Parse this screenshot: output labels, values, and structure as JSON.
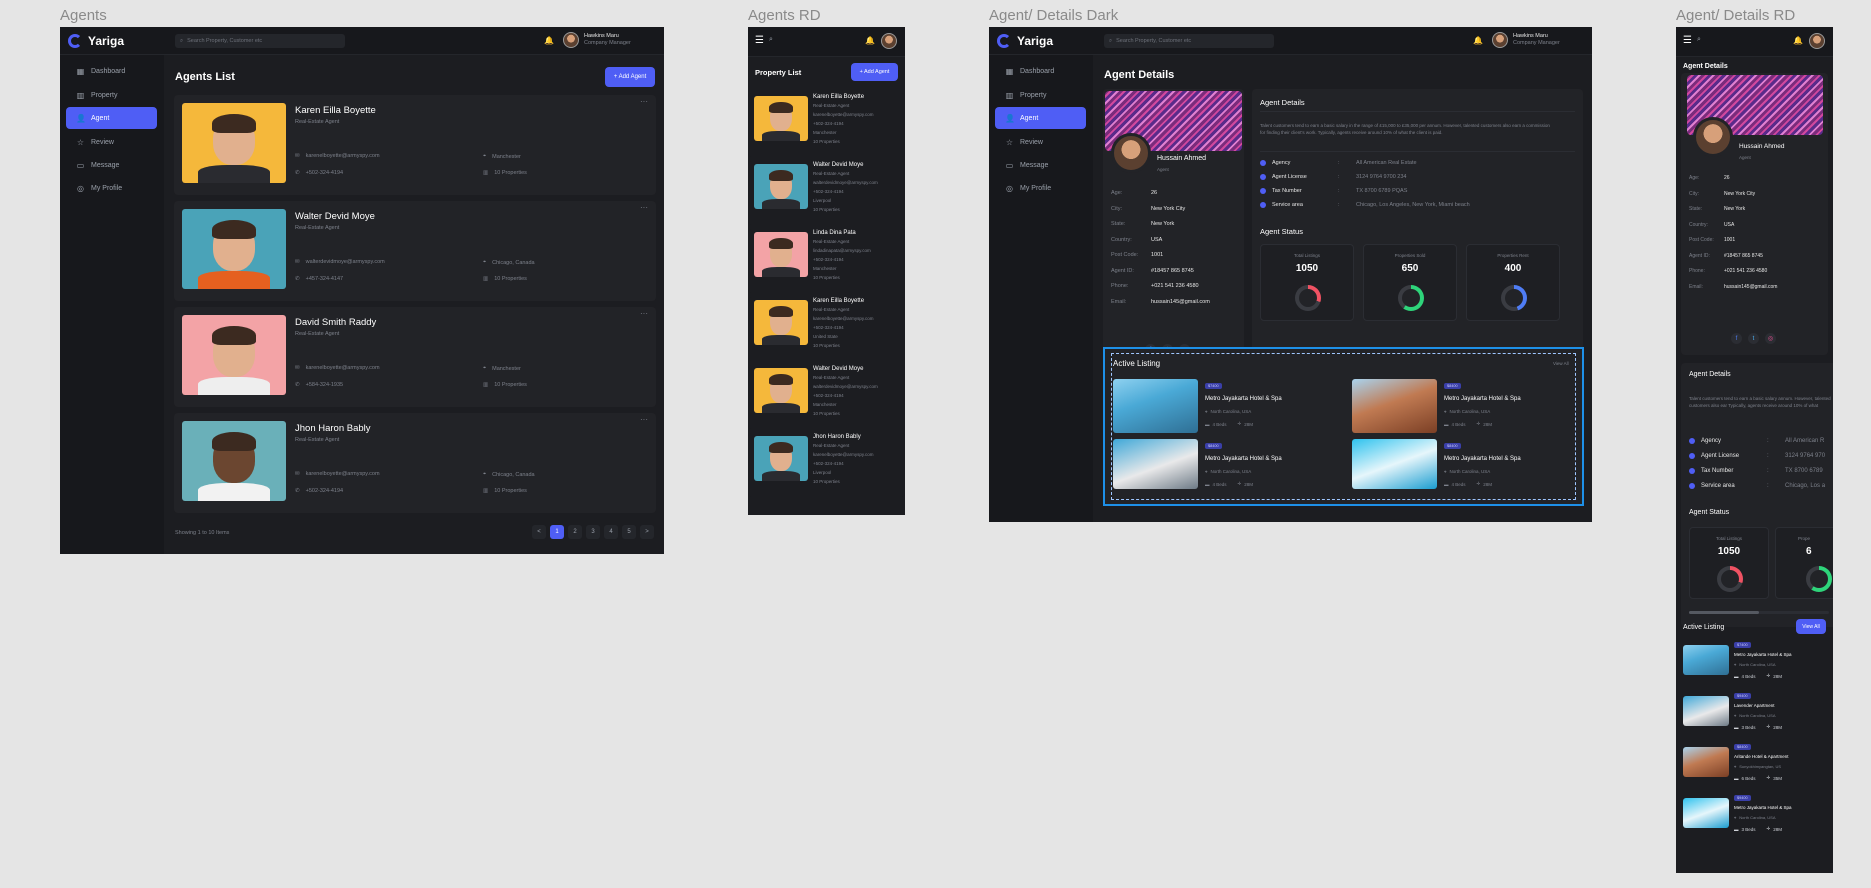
{
  "frames": {
    "agents": "Agents",
    "agents_rd": "Agents RD",
    "details_dark": "Agent/ Details Dark",
    "details_rd": "Agent/ Details RD"
  },
  "app": {
    "name": "Yariga",
    "search_placeholder": "Search Property, Customer etc",
    "user_name": "Hawkins Maru",
    "user_role": "Company Manager"
  },
  "nav": [
    "Dashboard",
    "Property",
    "Agent",
    "Review",
    "Message",
    "My Profile"
  ],
  "agents_list": {
    "title": "Agents List",
    "add_button": "+ Add Agent",
    "agents": [
      {
        "name": "Karen Eilla Boyette",
        "role": "Real-Estate Agent",
        "email": "karenelboyette@armyspy.com",
        "phone": "+502-324-4194",
        "location": "Manchester",
        "properties": "10 Properties"
      },
      {
        "name": "Walter Devid Moye",
        "role": "Real-Estate Agent",
        "email": "walterdevidmoye@armyspy.com",
        "phone": "+457-324-4147",
        "location": "Chicago, Canada",
        "properties": "10 Properties"
      },
      {
        "name": "David Smith Raddy",
        "role": "Real-Estate Agent",
        "email": "karenelboyette@armyspy.com",
        "phone": "+584-324-1935",
        "location": "Manchester",
        "properties": "10 Properties"
      },
      {
        "name": "Jhon Haron Bably",
        "role": "Real-Estate Agent",
        "email": "karenelboyette@armyspy.com",
        "phone": "+502-324-4194",
        "location": "Chicago, Canada",
        "properties": "10 Properties"
      }
    ],
    "showing": "Showing 1 to 10 Items",
    "pages": [
      "<",
      "1",
      "2",
      "3",
      "4",
      "5",
      ">"
    ]
  },
  "rd_list": {
    "title": "Property List",
    "add_button": "+ Add Agent",
    "agents": [
      {
        "name": "Karen Eilla Boyette",
        "role": "Real-Estate Agent",
        "email": "karenelboyette@armyspy.com",
        "phone": "+502-324-4194",
        "location": "Manchester",
        "properties": "10 Properties"
      },
      {
        "name": "Walter Devid Moye",
        "role": "Real-Estate Agent",
        "email": "walterdevidmoye@armyspy.com",
        "phone": "+502-324-4194",
        "location": "Liverpool",
        "properties": "10 Properties"
      },
      {
        "name": "Linda Dina Pata",
        "role": "Real-Estate Agent",
        "email": "lindadinapata@armyspy.com",
        "phone": "+502-324-4194",
        "location": "Manchester",
        "properties": "10 Properties"
      },
      {
        "name": "Karen Eilla Boyette",
        "role": "Real-Estate Agent",
        "email": "karenelboyette@armyspy.com",
        "phone": "+502-324-4194",
        "location": "United State",
        "properties": "10 Properties"
      },
      {
        "name": "Walter Devid Moye",
        "role": "Real-Estate Agent",
        "email": "walterdevidmoye@armyspy.com",
        "phone": "+502-324-4194",
        "location": "Manchester",
        "properties": "10 Properties"
      },
      {
        "name": "Jhon Haron Bably",
        "role": "Real-Estate Agent",
        "email": "karenelboyette@armyspy.com",
        "phone": "+502-324-4194",
        "location": "Liverpool",
        "properties": "10 Properties"
      }
    ]
  },
  "details": {
    "title": "Agent Details",
    "name": "Hussain Ahmed",
    "role": "Agent",
    "info": [
      {
        "k": "Age:",
        "v": "26"
      },
      {
        "k": "City:",
        "v": "New York City"
      },
      {
        "k": "State:",
        "v": "New York"
      },
      {
        "k": "Country:",
        "v": "USA"
      },
      {
        "k": "Post Code:",
        "v": "1001"
      },
      {
        "k": "Agent ID:",
        "v": "#18457 865 8745"
      },
      {
        "k": "Phone:",
        "v": "+021 541 236 4580"
      },
      {
        "k": "Email:",
        "v": "hussain145@gmail.com"
      }
    ],
    "panel_title": "Agent Details",
    "about": "Talent customers tend to earn a basic salary in the range of £15,000 to £35,000 per annum. However, talented customers also earn a commission for finding their client's work. Typically, agents receive around 10% of what the client is paid.",
    "facts": [
      {
        "k": "Agency",
        "v": "All American Real Estate"
      },
      {
        "k": "Agent License",
        "v": "3124 9764 9700 234"
      },
      {
        "k": "Tax Number",
        "v": "TX 8700 6789 PQAS"
      },
      {
        "k": "Service area",
        "v": "Chicago, Los Angeles, New York, Miami beach"
      }
    ],
    "status_title": "Agent Status",
    "stats": [
      {
        "label": "Total Listings",
        "value": "1050",
        "color": "#f05263",
        "frac": 0.3
      },
      {
        "label": "Properties Sold",
        "value": "650",
        "color": "#2ed47a",
        "frac": 0.6
      },
      {
        "label": "Properties Rent",
        "value": "400",
        "color": "#4f7df5",
        "frac": 0.45
      }
    ],
    "active_title": "Active Listing",
    "view_all": "View All",
    "listings": [
      {
        "tag": "$7400",
        "name": "Metro Jayakarta Hotel & Spa",
        "loc": "North Carolina, USA",
        "beds": "4 Beds",
        "area": "28M"
      },
      {
        "tag": "$8400",
        "name": "Metro Jayakarta Hotel & Spa",
        "loc": "North Carolina, USA",
        "beds": "4 Beds",
        "area": "28M"
      },
      {
        "tag": "$8400",
        "name": "Metro Jayakarta Hotel & Spa",
        "loc": "North Carolina, USA",
        "beds": "4 Beds",
        "area": "28M"
      },
      {
        "tag": "$8400",
        "name": "Metro Jayakarta Hotel & Spa",
        "loc": "North Carolina, USA",
        "beds": "4 Beds",
        "area": "28M"
      }
    ]
  },
  "rd_details": {
    "title": "Agent Details",
    "panel_title": "Agent Details",
    "facts": [
      {
        "k": "Agency",
        "v": "All American R"
      },
      {
        "k": "Agent License",
        "v": "3124 9764 970"
      },
      {
        "k": "Tax Number",
        "v": "TX 8700 6789"
      },
      {
        "k": "Service area",
        "v": "Chicago, Los a"
      }
    ],
    "about": "Talent customers tend to earn a basic salary annum. However, talented customers also ear Typically, agents receive around 10% of what",
    "status_title": "Agent Status",
    "stat_label": "Total Listings",
    "stat_value": "1050",
    "stat_label2": "Prope",
    "stat_value2": "6",
    "active_title": "Active Listing",
    "view_all": "View All",
    "listings": [
      {
        "tag": "$7400",
        "name": "Metro Jayakarta Hotel & Spa",
        "loc": "North Carolina, USA",
        "beds": "4 Beds",
        "area": "28M"
      },
      {
        "tag": "$9400",
        "name": "Lavender Apartment",
        "loc": "North Carolina, USA",
        "beds": "3 Beds",
        "area": "28M"
      },
      {
        "tag": "$8400",
        "name": "Aritande Hotel & Apartment",
        "loc": "Sunyokhimyangtan, US",
        "beds": "6 Beds",
        "area": "35M"
      },
      {
        "tag": "$9400",
        "name": "Metro Jayakarta Hotel & Spa",
        "loc": "North Carolina, USA",
        "beds": "3 Beds",
        "area": "28M"
      }
    ]
  }
}
